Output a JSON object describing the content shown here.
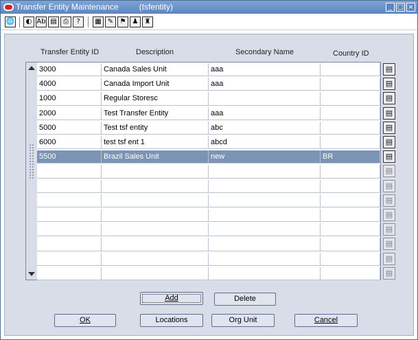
{
  "window": {
    "title": "Transfer Entity Maintenance",
    "form_code": "(tsfentity)",
    "controls": [
      "_",
      "□",
      "×"
    ]
  },
  "toolbar": {
    "icons": [
      {
        "name": "globe-icon",
        "glyph": "🌐"
      },
      {
        "name": "back-icon",
        "glyph": "◐"
      },
      {
        "name": "spell-icon",
        "glyph": "Ab"
      },
      {
        "name": "save-icon",
        "glyph": "▤"
      },
      {
        "name": "print-icon",
        "glyph": "⎙"
      },
      {
        "name": "help-icon",
        "glyph": "?"
      },
      {
        "name": "grid-icon",
        "glyph": "▦"
      },
      {
        "name": "edit-icon",
        "glyph": "✎"
      },
      {
        "name": "folder-icon",
        "glyph": "⚑"
      },
      {
        "name": "users-icon",
        "glyph": "♟"
      },
      {
        "name": "org-icon",
        "glyph": "♜"
      }
    ]
  },
  "table": {
    "headers": {
      "id": "Transfer Entity ID",
      "description": "Description",
      "secondary_name": "Secondary Name",
      "country": "Country ID"
    },
    "rows": [
      {
        "id": "3000",
        "description": "Canada Sales Unit",
        "secondary_name": "aaa",
        "country": ""
      },
      {
        "id": "4000",
        "description": "Canada Import Unit",
        "secondary_name": "aaa",
        "country": ""
      },
      {
        "id": "1000",
        "description": "Regular Storesc",
        "secondary_name": "",
        "country": ""
      },
      {
        "id": "2000",
        "description": "Test Transfer Entity",
        "secondary_name": "aaa",
        "country": ""
      },
      {
        "id": "5000",
        "description": "Test tsf entity",
        "secondary_name": "abc",
        "country": ""
      },
      {
        "id": "6000",
        "description": "test tsf ent 1",
        "secondary_name": "abcd",
        "country": ""
      },
      {
        "id": "5500",
        "description": "Brazil Sales Unit",
        "secondary_name": "new",
        "country": "BR",
        "selected": true
      },
      {
        "id": "",
        "description": "",
        "secondary_name": "",
        "country": ""
      },
      {
        "id": "",
        "description": "",
        "secondary_name": "",
        "country": ""
      },
      {
        "id": "",
        "description": "",
        "secondary_name": "",
        "country": ""
      },
      {
        "id": "",
        "description": "",
        "secondary_name": "",
        "country": ""
      },
      {
        "id": "",
        "description": "",
        "secondary_name": "",
        "country": ""
      },
      {
        "id": "",
        "description": "",
        "secondary_name": "",
        "country": ""
      },
      {
        "id": "",
        "description": "",
        "secondary_name": "",
        "country": ""
      },
      {
        "id": "",
        "description": "",
        "secondary_name": "",
        "country": ""
      }
    ],
    "row_button_icon": "▤"
  },
  "buttons": {
    "add": "Add",
    "delete": "Delete",
    "ok": "OK",
    "locations": "Locations",
    "org_unit": "Org Unit",
    "cancel": "Cancel"
  },
  "colors": {
    "titlebar": "#5d86c0",
    "panel": "#d9dde8",
    "selected_row": "#7b93b4"
  }
}
